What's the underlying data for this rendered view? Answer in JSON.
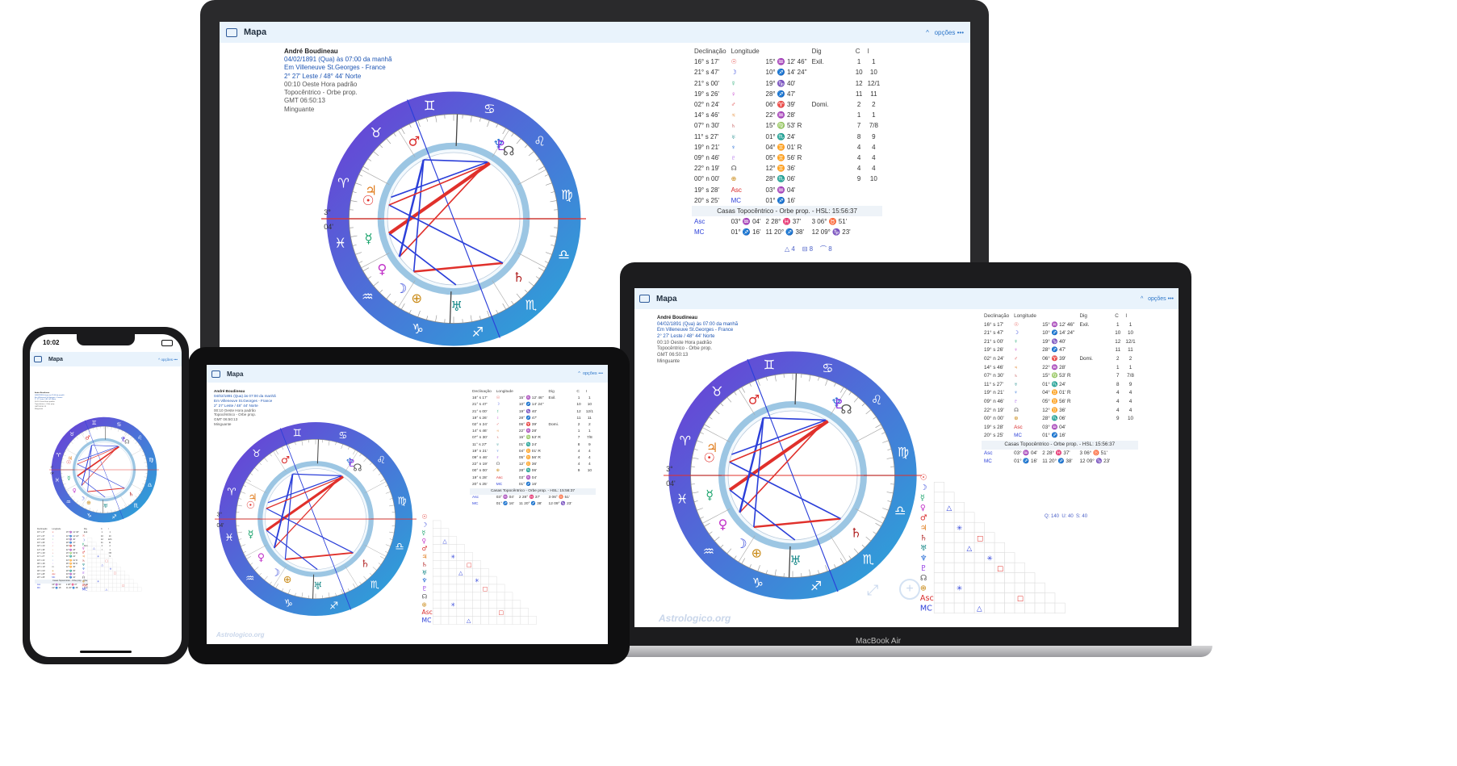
{
  "app": {
    "title": "Mapa",
    "options_label": "opções",
    "dots": "•••",
    "collapse": "^"
  },
  "phone": {
    "time": "10:02"
  },
  "macbook": {
    "label": "MacBook Air"
  },
  "watermark": "Astrologico.org",
  "person": {
    "name": "André Boudineau",
    "date_line": "04/02/1891 (Qua) às 07:00 da manhã",
    "place_line": "Em Villeneuve St.Georges - France",
    "coords": "2° 27' Leste / 48° 44' Norte",
    "tz_line": "00:10 Oeste Hora padrão",
    "system": "Topocêntrico - Orbe prop.",
    "gmt": "GMT 06:50:13",
    "moon_phase": "Minguante"
  },
  "table": {
    "headers": [
      "Declinação",
      "Longitude",
      "Dig",
      "C",
      "I"
    ],
    "rows": [
      {
        "decl": "16° s 17'",
        "sym": "☉",
        "long": "15° ♒ 12' 46''",
        "dig": "Exil.",
        "c": "1",
        "i": "1",
        "col": "#e0302b"
      },
      {
        "decl": "21° s 47'",
        "sym": "☽",
        "long": "10° ♐ 14' 24''",
        "dig": "",
        "c": "10",
        "i": "10",
        "col": "#2b3fd9"
      },
      {
        "decl": "21° s 00'",
        "sym": "☿",
        "long": "19° ♑ 40'",
        "dig": "",
        "c": "12",
        "i": "12/1",
        "col": "#18a36b"
      },
      {
        "decl": "19° s 26'",
        "sym": "♀",
        "long": "28° ♐ 47'",
        "dig": "",
        "c": "11",
        "i": "11",
        "col": "#c030c8"
      },
      {
        "decl": "02° n 24'",
        "sym": "♂",
        "long": "06° ♈ 39'",
        "dig": "Domi.",
        "c": "2",
        "i": "2",
        "col": "#d92b2b"
      },
      {
        "decl": "14° s 46'",
        "sym": "♃",
        "long": "22° ♒ 28'",
        "dig": "",
        "c": "1",
        "i": "1",
        "col": "#e07b1a"
      },
      {
        "decl": "07° n 30'",
        "sym": "♄",
        "long": "15° ♍ 53' R",
        "dig": "",
        "c": "7",
        "i": "7/8",
        "col": "#b02020"
      },
      {
        "decl": "11° s 27'",
        "sym": "♅",
        "long": "01° ♏ 24'",
        "dig": "",
        "c": "8",
        "i": "9",
        "col": "#1b8a8a"
      },
      {
        "decl": "19° n 21'",
        "sym": "♆",
        "long": "04° ♊ 01' R",
        "dig": "",
        "c": "4",
        "i": "4",
        "col": "#2a6fd6"
      },
      {
        "decl": "09° n 46'",
        "sym": "♇",
        "long": "05° ♊ 56' R",
        "dig": "",
        "c": "4",
        "i": "4",
        "col": "#8a2be2"
      },
      {
        "decl": "22° n 19'",
        "sym": "☊",
        "long": "12° ♊ 36'",
        "dig": "",
        "c": "4",
        "i": "4",
        "col": "#555"
      },
      {
        "decl": "00° n 00'",
        "sym": "⊕",
        "long": "28° ♏ 06'",
        "dig": "",
        "c": "9",
        "i": "10",
        "col": "#c98a16"
      },
      {
        "decl": "19° s 28'",
        "sym": "Asc",
        "long": "03° ♒ 04'",
        "dig": "",
        "c": "",
        "i": "",
        "col": "#d92b2b"
      },
      {
        "decl": "20° s 25'",
        "sym": "MC",
        "long": "01° ♐ 16'",
        "dig": "",
        "c": "",
        "i": "",
        "col": "#2b3fd9"
      }
    ],
    "houses_caption": "Casas Topocêntrico - Orbe prop. - HSL: 15:56:37",
    "houses": [
      {
        "label": "Asc",
        "cells": [
          "03° ♒ 04'",
          "2 28° ♓ 37'",
          "3 06° ♉ 51'"
        ]
      },
      {
        "label": "MC",
        "cells": [
          "01° ♐ 16'",
          "11 20° ♐ 38'",
          "12 09° ♑ 23'"
        ]
      }
    ]
  },
  "aspects_summary": {
    "trine": "4",
    "square": "8",
    "sextile": "8"
  },
  "aspect_stats": {
    "q": "Q: 140",
    "u": "U: 40",
    "s": "S: 40"
  },
  "colors": {
    "accent": "#2d76c9",
    "red": "#e0302b",
    "blue": "#2b3fd9",
    "ring_a": "#6b3fd6",
    "ring_b": "#2aa6d9"
  },
  "wheel": {
    "signs": [
      "♈",
      "♉",
      "♊",
      "♋",
      "♌",
      "♍",
      "♎",
      "♏",
      "♐",
      "♑",
      "♒",
      "♓"
    ],
    "asc_label": "3°",
    "asc_min": "04'",
    "mc_label": "1°",
    "mc_min": "16'"
  },
  "icons": [
    "map-icon",
    "chevron-up-icon",
    "more-dots-icon",
    "expand-icon",
    "add-icon"
  ]
}
